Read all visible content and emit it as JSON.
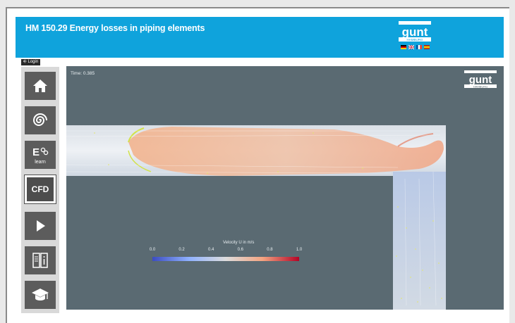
{
  "header": {
    "title": "HM 150.29 Energy losses in piping elements",
    "logo_text": "gunt",
    "logo_subtext": "HAMBURG",
    "languages": [
      {
        "name": "german-flag-icon",
        "colors": [
          "#000000",
          "#dd0000",
          "#ffce00"
        ]
      },
      {
        "name": "uk-flag-icon",
        "colors": [
          "#012169",
          "#ffffff",
          "#c8102e"
        ]
      },
      {
        "name": "france-flag-icon",
        "colors": [
          "#0055a4",
          "#ffffff",
          "#ef4135"
        ]
      },
      {
        "name": "spain-flag-icon",
        "colors": [
          "#aa151b",
          "#f1bf00",
          "#aa151b"
        ]
      }
    ]
  },
  "sidebar": {
    "login_label": "Login",
    "items": [
      {
        "icon": "home-icon",
        "label": "",
        "active": false
      },
      {
        "icon": "swirl-icon",
        "label": "",
        "active": false
      },
      {
        "icon": "elearn-icon",
        "label": "learn",
        "active": false
      },
      {
        "icon": "cfd-icon",
        "label": "CFD",
        "active": true
      },
      {
        "icon": "play-icon",
        "label": "",
        "active": false
      },
      {
        "icon": "info-book-icon",
        "label": "",
        "active": false
      },
      {
        "icon": "graduation-cap-icon",
        "label": "",
        "active": false
      }
    ]
  },
  "viewport": {
    "time_label": "Time: 0.385",
    "logo_text": "gunt",
    "logo_subtext": "HAMBURG",
    "colorbar": {
      "title": "Velocity U in m/s",
      "ticks": [
        "0.0",
        "0.2",
        "0.4",
        "0.6",
        "0.8",
        "1.0"
      ],
      "colormap": [
        "#3b4cc0",
        "#8fb1fe",
        "#dddddd",
        "#f3a481",
        "#b40426"
      ]
    }
  },
  "colors": {
    "header_bg": "#0fa3dc",
    "viewport_bg": "#5a6a72",
    "sidebar_button": "#5c5c5c"
  }
}
